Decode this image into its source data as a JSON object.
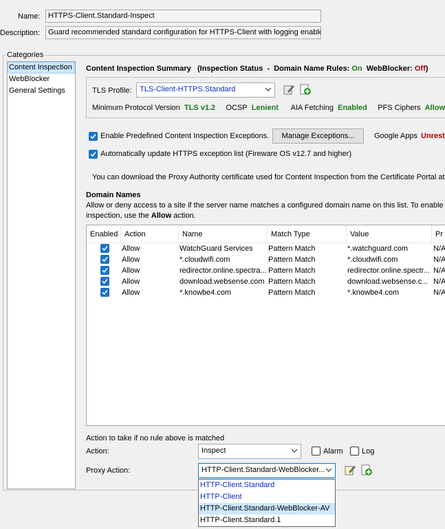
{
  "header": {
    "name_label": "Name:",
    "name_value": "HTTPS-Client.Standard-Inspect",
    "desc_label": "Description:",
    "desc_value": "Guard recommended standard configuration for HTTPS-Client with logging enabled"
  },
  "categories": {
    "title": "Categories",
    "items": [
      {
        "label": "Content Inspection"
      },
      {
        "label": "WebBlocker"
      },
      {
        "label": "General Settings"
      }
    ]
  },
  "summary": {
    "title": "Content Inspection Summary",
    "status_open": "(Inspection Status",
    "dash": "-",
    "domain_rules_label": "Domain Name Rules:",
    "domain_rules_value": "On",
    "webblocker_label": "WebBlocker:",
    "webblocker_value": "Off",
    "close": ")"
  },
  "tls": {
    "profile_label": "TLS Profile:",
    "profile_value": "TLS-Client-HTTPS.Standard",
    "min_proto_label": "Minimum Protocol Version",
    "min_proto_value": "TLS v1.2",
    "ocsp_label": "OCSP",
    "ocsp_value": "Lenient",
    "aia_label": "AIA Fetching",
    "aia_value": "Enabled",
    "pfs_label": "PFS Ciphers",
    "pfs_value": "Allowed"
  },
  "options": {
    "enable_exceptions_label": "Enable Predefined Content Inspection Exceptions.",
    "manage_exceptions_button": "Manage Exceptions...",
    "google_apps_label": "Google Apps",
    "google_apps_value": "Unrest",
    "auto_update_label": "Automatically update HTTPS exception list (Fireware OS v12.7 and higher)",
    "download_note": "You can download the Proxy Authority certificate used for Content Inspection from the Certificate Portal at"
  },
  "domains": {
    "title": "Domain Names",
    "desc_line1": "Allow or deny access to a site if the server name matches a configured domain name on this list. To enable c",
    "desc_line2_pre": "inspection, use the ",
    "desc_line2_bold": "Allow",
    "desc_line2_post": " action.",
    "columns": [
      "Enabled",
      "Action",
      "Name",
      "Match Type",
      "Value",
      "Pr"
    ],
    "rows": [
      {
        "enabled": true,
        "action": "Allow",
        "name": "WatchGuard Services",
        "match": "Pattern Match",
        "value": "*.watchguard.com",
        "pr": "N/A"
      },
      {
        "enabled": true,
        "action": "Allow",
        "name": "*.cloudwifi.com",
        "match": "Pattern Match",
        "value": "*.cloudwifi.com",
        "pr": "N/A"
      },
      {
        "enabled": true,
        "action": "Allow",
        "name": "redirector.online.spectra...",
        "match": "Pattern Match",
        "value": "redirector.online.spectr...",
        "pr": "N/A"
      },
      {
        "enabled": true,
        "action": "Allow",
        "name": "download.websense.com",
        "match": "Pattern Match",
        "value": "download.websense.c...",
        "pr": "N/A"
      },
      {
        "enabled": true,
        "action": "Allow",
        "name": "*.knowbe4.com",
        "match": "Pattern Match",
        "value": "*.knowbe4.com",
        "pr": "N/A"
      }
    ]
  },
  "fallback": {
    "title": "Action to take if no rule above is matched",
    "action_label": "Action:",
    "action_value": "Inspect",
    "alarm_label": "Alarm",
    "log_label": "Log",
    "proxy_action_label": "Proxy Action:",
    "proxy_action_value": "HTTP-Client.Standard-WebBlocker...",
    "proxy_options": [
      {
        "label": "HTTP-Client.Standard"
      },
      {
        "label": "HTTP-Client"
      },
      {
        "label": "HTTP-Client.Standard-WebBlocker-AV"
      },
      {
        "label": "HTTP-Client.Standard.1"
      }
    ]
  },
  "colors": {
    "accent": "#1a73c8",
    "on_green": "#1a7a1a",
    "off_red": "#b00000",
    "link_blue": "#0a2ccf",
    "selection": "#cce8ff"
  }
}
